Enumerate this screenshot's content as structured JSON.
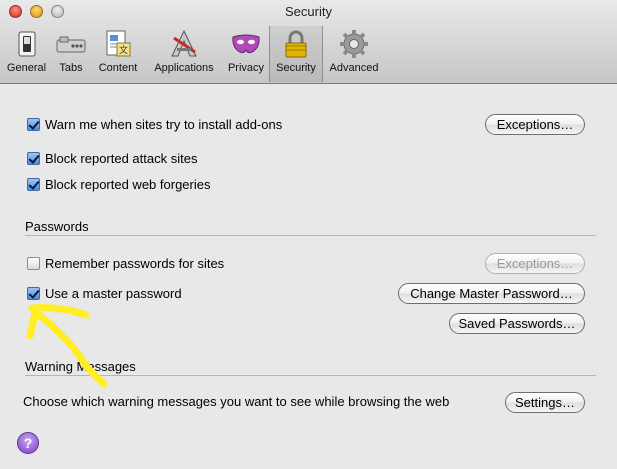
{
  "window": {
    "title": "Security"
  },
  "toolbar": {
    "items": [
      {
        "label": "General",
        "icon": "general-switch-icon"
      },
      {
        "label": "Tabs",
        "icon": "tabs-icon"
      },
      {
        "label": "Content",
        "icon": "content-document-icon"
      },
      {
        "label": "Applications",
        "icon": "applications-icon"
      },
      {
        "label": "Privacy",
        "icon": "privacy-mask-icon"
      },
      {
        "label": "Security",
        "icon": "security-lock-icon",
        "selected": true
      },
      {
        "label": "Advanced",
        "icon": "advanced-gear-icon"
      }
    ]
  },
  "addons": {
    "warn_label": "Warn me when sites try to install add-ons",
    "warn_checked": true,
    "exceptions_label": "Exceptions…",
    "block_attack_label": "Block reported attack sites",
    "block_attack_checked": true,
    "block_forgeries_label": "Block reported web forgeries",
    "block_forgeries_checked": true
  },
  "passwords": {
    "heading": "Passwords",
    "remember_label": "Remember passwords for sites",
    "remember_checked": false,
    "exceptions_label": "Exceptions…",
    "master_label": "Use a master password",
    "master_checked": true,
    "change_master_label": "Change Master Password…",
    "saved_passwords_label": "Saved Passwords…"
  },
  "warnings": {
    "heading": "Warning Messages",
    "description": "Choose which warning messages you want to see while browsing the web",
    "settings_label": "Settings…"
  },
  "help": {
    "label": "?"
  },
  "annotation": {
    "color": "#ffee22"
  }
}
